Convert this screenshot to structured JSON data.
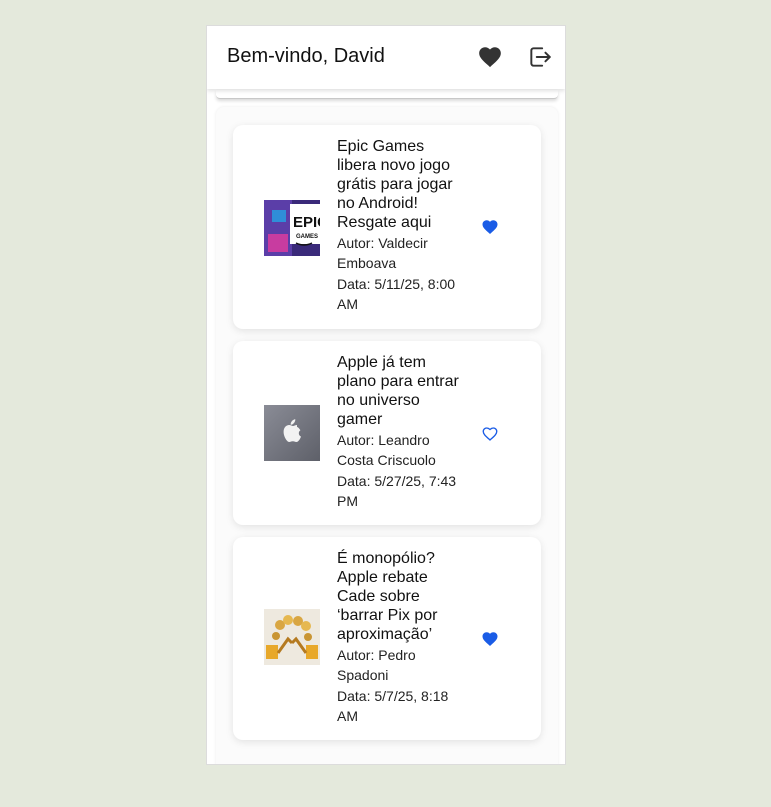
{
  "header": {
    "greeting": "Bem-vindo, David",
    "favorites_icon": "heart-icon",
    "logout_icon": "logout-icon"
  },
  "colors": {
    "background": "#e4e9dc",
    "accent": "#1a5ce6",
    "header_icon": "#333333"
  },
  "articles": [
    {
      "title": "Epic Games libera novo jogo grátis para jogar no Android! Resgate aqui",
      "author": "Autor: Valdecir Emboava",
      "date": "Data: 5/11/25, 8:00 AM",
      "favorited": true,
      "image": "epic-games-logo"
    },
    {
      "title": "Apple já tem plano para entrar no universo gamer",
      "author": "Autor: Leandro Costa Criscuolo",
      "date": "Data: 5/27/25, 7:43 PM",
      "favorited": false,
      "image": "apple-logo"
    },
    {
      "title": "É monopólio? Apple rebate Cade sobre ‘barrar Pix por aproximação’",
      "author": "Autor: Pedro Spadoni",
      "date": "Data: 5/7/25, 8:18 AM",
      "favorited": true,
      "image": "coins-illustration"
    }
  ]
}
